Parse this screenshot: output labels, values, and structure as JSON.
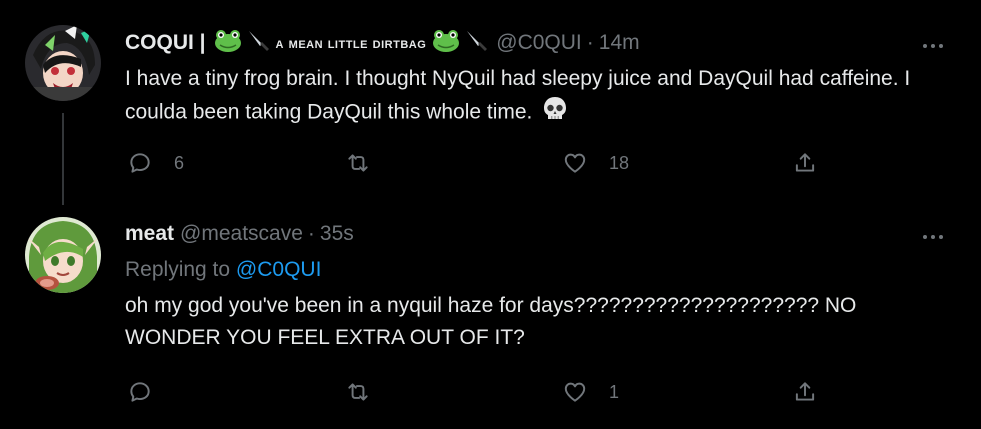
{
  "tweets": [
    {
      "display_name": "COQUI |",
      "display_name_tail": "a mean little dirtbag",
      "handle": "@C0QUI",
      "separator": "·",
      "time": "14m",
      "text": "I have a tiny frog brain. I thought NyQuil had sleepy juice and DayQuil had caffeine. I coulda been taking DayQuil this whole time.",
      "trailing_emoji": "💀",
      "actions": {
        "reply_count": "6",
        "retweet_count": "",
        "like_count": "18"
      }
    },
    {
      "display_name": "meat",
      "handle": "@meatscave",
      "separator": "·",
      "time": "35s",
      "replying_prefix": "Replying to",
      "replying_to": "@C0QUI",
      "text": "oh my god you've been in a nyquil haze for days????????????????????? NO WONDER YOU FEEL EXTRA OUT OF IT?",
      "actions": {
        "reply_count": "",
        "retweet_count": "",
        "like_count": "1"
      }
    }
  ],
  "icons": {
    "more": "more-horizontal-icon",
    "reply": "reply-bubble-icon",
    "retweet": "retweet-icon",
    "like": "heart-icon",
    "share": "share-icon",
    "frog": "frog-emoji",
    "knife": "knife-emoji",
    "skull": "skull-emoji"
  },
  "colors": {
    "background": "#000000",
    "text": "#e7e9ea",
    "muted": "#71767b",
    "link": "#1d9bf0",
    "thread_line": "#333639"
  }
}
